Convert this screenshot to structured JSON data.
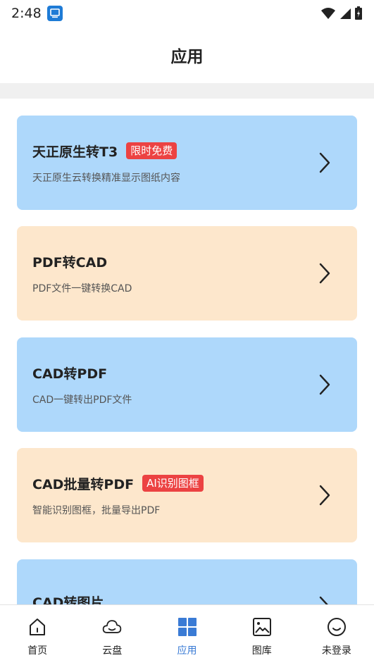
{
  "status_bar": {
    "time": "2:48"
  },
  "header": {
    "title": "应用"
  },
  "cards": [
    {
      "title": "天正原生转T3",
      "badge": "限时免费",
      "subtitle": "天正原生云转换精准显示图纸内容",
      "color": "#aed8fb"
    },
    {
      "title": "PDF转CAD",
      "badge": "",
      "subtitle": "PDF文件一键转换CAD",
      "color": "#fde7cc"
    },
    {
      "title": "CAD转PDF",
      "badge": "",
      "subtitle": "CAD一键转出PDF文件",
      "color": "#aed8fb"
    },
    {
      "title": "CAD批量转PDF",
      "badge": "AI识别图框",
      "subtitle": "智能识别图框，批量导出PDF",
      "color": "#fde7cc"
    },
    {
      "title": "CAD转图片",
      "badge": "",
      "subtitle": "",
      "color": "#aed8fb"
    }
  ],
  "bottom_nav": {
    "items": [
      {
        "label": "首页",
        "icon": "home-icon"
      },
      {
        "label": "云盘",
        "icon": "cloud-icon"
      },
      {
        "label": "应用",
        "icon": "apps-grid-icon",
        "active": true
      },
      {
        "label": "图库",
        "icon": "gallery-icon"
      },
      {
        "label": "未登录",
        "icon": "smiley-icon"
      }
    ]
  },
  "colors": {
    "accent": "#3a7bd5",
    "badge": "#ec4242",
    "blue_card": "#aed8fb",
    "orange_card": "#fde7cc"
  }
}
